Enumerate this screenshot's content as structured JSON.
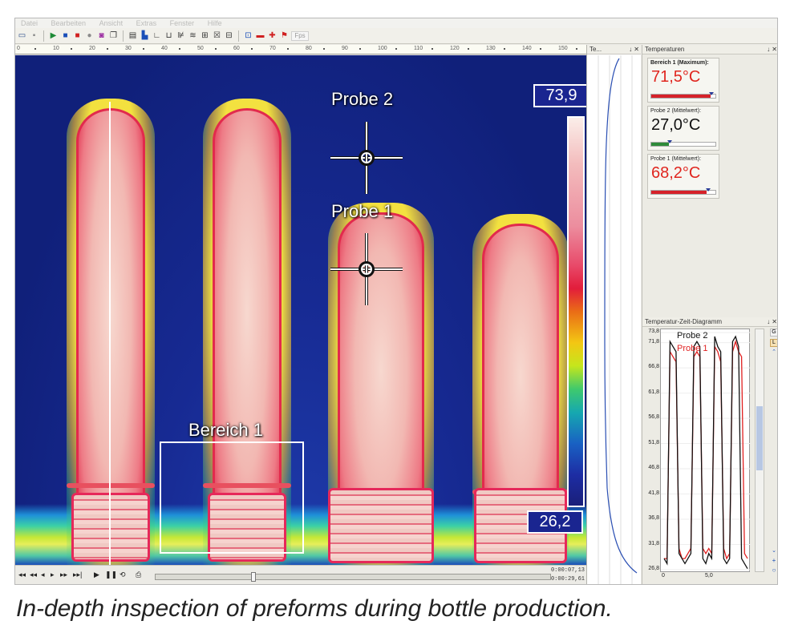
{
  "menubar": {
    "items": [
      "Datei",
      "Bearbeiten",
      "Ansicht",
      "Extras",
      "Fenster",
      "Hilfe"
    ]
  },
  "toolbar": {
    "fps_label": "Fps"
  },
  "ruler": {
    "ticks": [
      "0",
      "10",
      "20",
      "30",
      "40",
      "50",
      "60",
      "70",
      "80",
      "90",
      "100",
      "110",
      "120",
      "130",
      "140",
      "150"
    ]
  },
  "image": {
    "probe2_label": "Probe 2",
    "probe1_label": "Probe 1",
    "region_label": "Bereich 1",
    "scale_max": "73,9",
    "scale_min": "26,2"
  },
  "playback": {
    "time_current": "0:00:07,13",
    "time_total": "0:00:29,61",
    "position": 0.24
  },
  "profile_panel": {
    "title": "Te...",
    "controls": "↓ ✕"
  },
  "temps_panel": {
    "title": "Temperaturen",
    "controls": "↓ ✕",
    "meters": [
      {
        "label": "Bereich 1 (Maximum):",
        "value": "71,5°C",
        "color": "#e0261f",
        "fill": 0.92,
        "fill_color": "#d6222a"
      },
      {
        "label": "Probe 2 (Mittelwert):",
        "value": "27,0°C",
        "color": "#111111",
        "fill": 0.28,
        "fill_color": "#2e8b3a"
      },
      {
        "label": "Probe 1 (Mittelwert):",
        "value": "68,2°C",
        "color": "#e0261f",
        "fill": 0.86,
        "fill_color": "#d6222a"
      }
    ]
  },
  "chart_panel": {
    "title": "Temperatur-Zeit-Diagramm",
    "controls": "↓ ✕",
    "side_buttons": [
      "G",
      "L"
    ]
  },
  "chart_data": {
    "type": "line",
    "title": "Temperatur-Zeit-Diagramm",
    "xlabel": "",
    "ylabel": "",
    "ylim": [
      26.8,
      73.8
    ],
    "yticks": [
      "73,8",
      "71,8",
      "66,8",
      "61,8",
      "56,8",
      "51,8",
      "46,8",
      "41,8",
      "36,8",
      "31,8",
      "26,8"
    ],
    "xticks": [
      "0",
      "5,0"
    ],
    "series": [
      {
        "name": "Probe 2",
        "color": "#111111",
        "values": [
          29,
          28,
          72,
          71,
          70,
          30,
          29,
          28,
          29,
          30,
          71,
          72,
          71,
          29,
          28,
          30,
          29,
          73,
          71,
          70,
          29,
          28,
          29,
          72,
          73,
          71,
          29,
          28,
          27
        ]
      },
      {
        "name": "Probe 1",
        "color": "#e02020",
        "values": [
          29,
          29,
          70,
          69,
          68,
          31,
          29,
          29,
          30,
          31,
          69,
          70,
          69,
          31,
          30,
          31,
          30,
          71,
          70,
          68,
          31,
          29,
          30,
          70,
          72,
          70,
          69,
          30,
          29
        ]
      }
    ]
  },
  "caption": "In-depth inspection of preforms during bottle production."
}
